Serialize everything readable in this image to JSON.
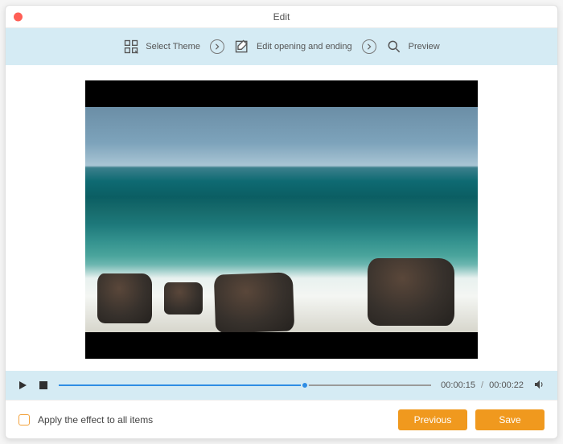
{
  "window": {
    "title": "Edit"
  },
  "toolbar": {
    "select_theme": "Select Theme",
    "edit_opening": "Edit opening and ending",
    "preview": "Preview"
  },
  "playback": {
    "current": "00:00:15",
    "total": "00:00:22"
  },
  "footer": {
    "apply_all": "Apply the effect to all items",
    "previous": "Previous",
    "save": "Save"
  },
  "icons": {
    "theme": "theme-grid-icon",
    "edit": "edit-square-icon",
    "preview": "magnifier-icon",
    "play": "play-icon",
    "stop": "stop-icon",
    "volume": "volume-icon",
    "chevron": "chevron-right-icon"
  },
  "colors": {
    "accent": "#f0991e",
    "toolbar_bg": "#d5ebf4",
    "progress": "#2f8de4"
  }
}
